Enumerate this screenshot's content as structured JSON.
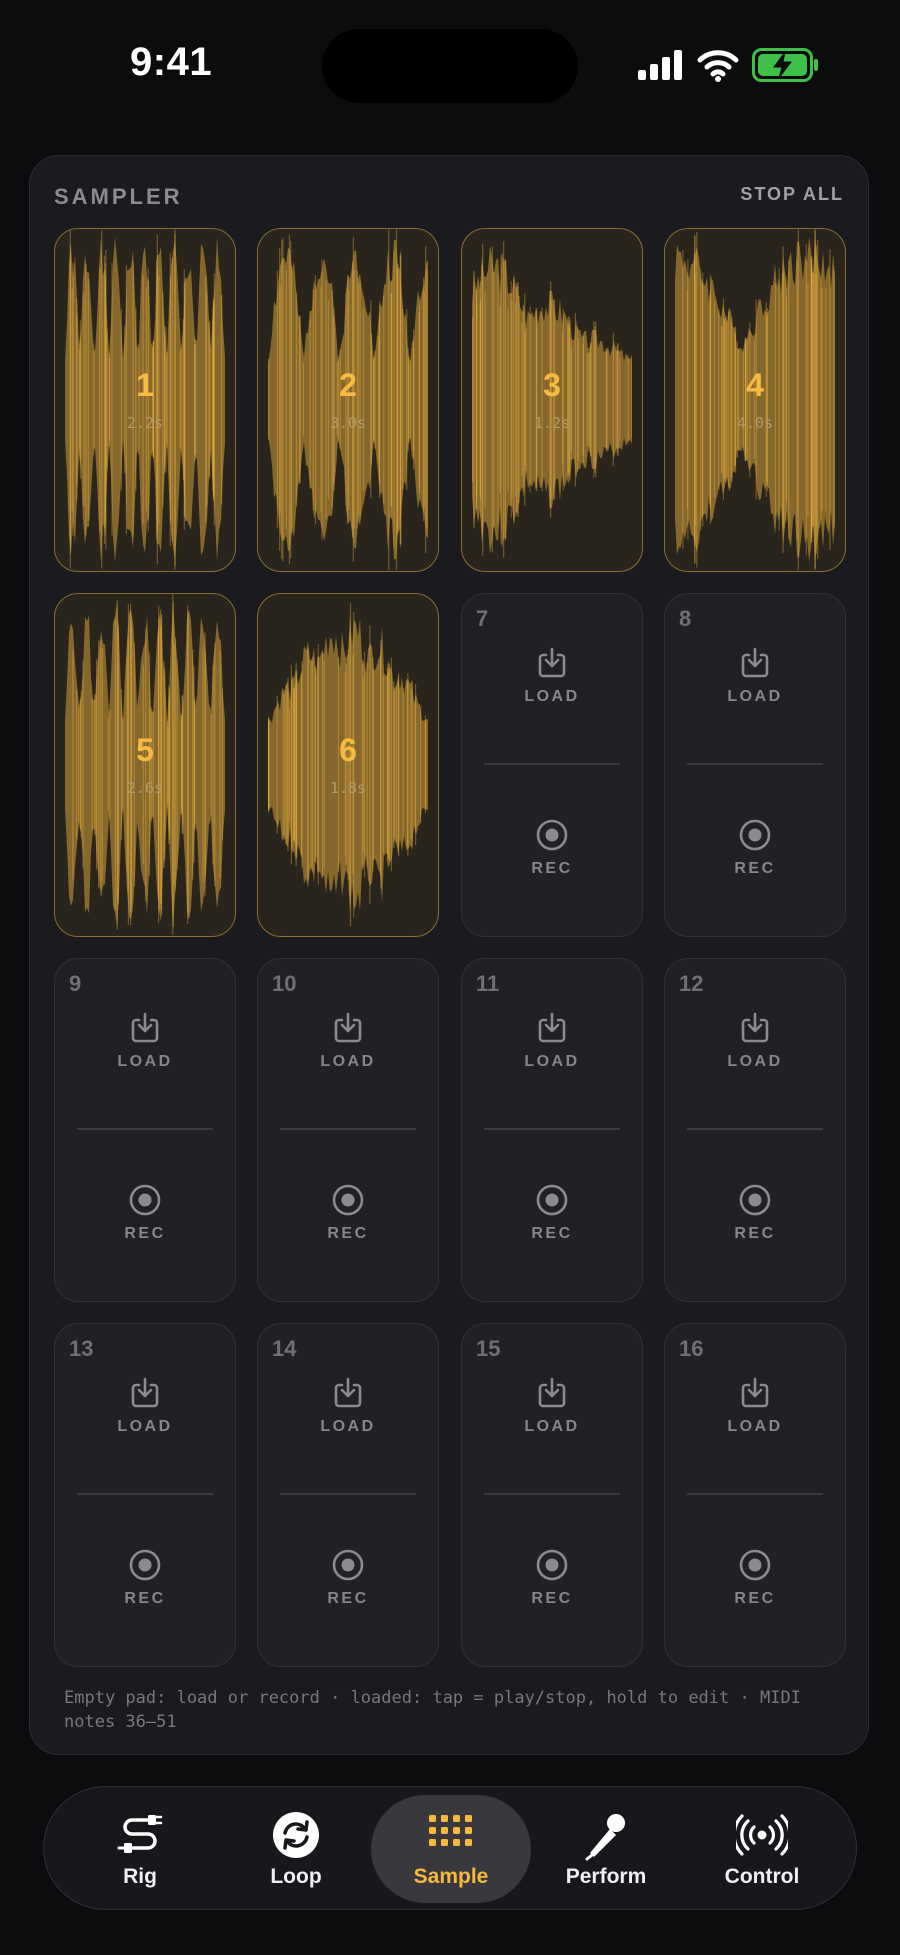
{
  "status_bar": {
    "time": "9:41"
  },
  "sampler": {
    "title": "SAMPLER",
    "stop_all_label": "STOP ALL",
    "accent_color": "#f7bb43",
    "loaded_pads": [
      {
        "number": "1",
        "duration": "2.2s"
      },
      {
        "number": "2",
        "duration": "3.0s"
      },
      {
        "number": "3",
        "duration": "1.2s"
      },
      {
        "number": "4",
        "duration": "4.0s"
      },
      {
        "number": "5",
        "duration": "2.6s"
      },
      {
        "number": "6",
        "duration": "1.8s"
      }
    ],
    "empty_pads": [
      "7",
      "8",
      "9",
      "10",
      "11",
      "12",
      "13",
      "14",
      "15",
      "16"
    ],
    "load_label": "LOAD",
    "rec_label": "REC",
    "hint": "Empty pad: load or record · loaded: tap = play/stop, hold to edit · MIDI notes 36–51"
  },
  "tabs": [
    {
      "label": "Rig",
      "icon": "cable-icon"
    },
    {
      "label": "Loop",
      "icon": "loop-icon"
    },
    {
      "label": "Sample",
      "icon": "pad-grid-icon",
      "active": true
    },
    {
      "label": "Perform",
      "icon": "microphone-icon"
    },
    {
      "label": "Control",
      "icon": "broadcast-icon"
    }
  ]
}
